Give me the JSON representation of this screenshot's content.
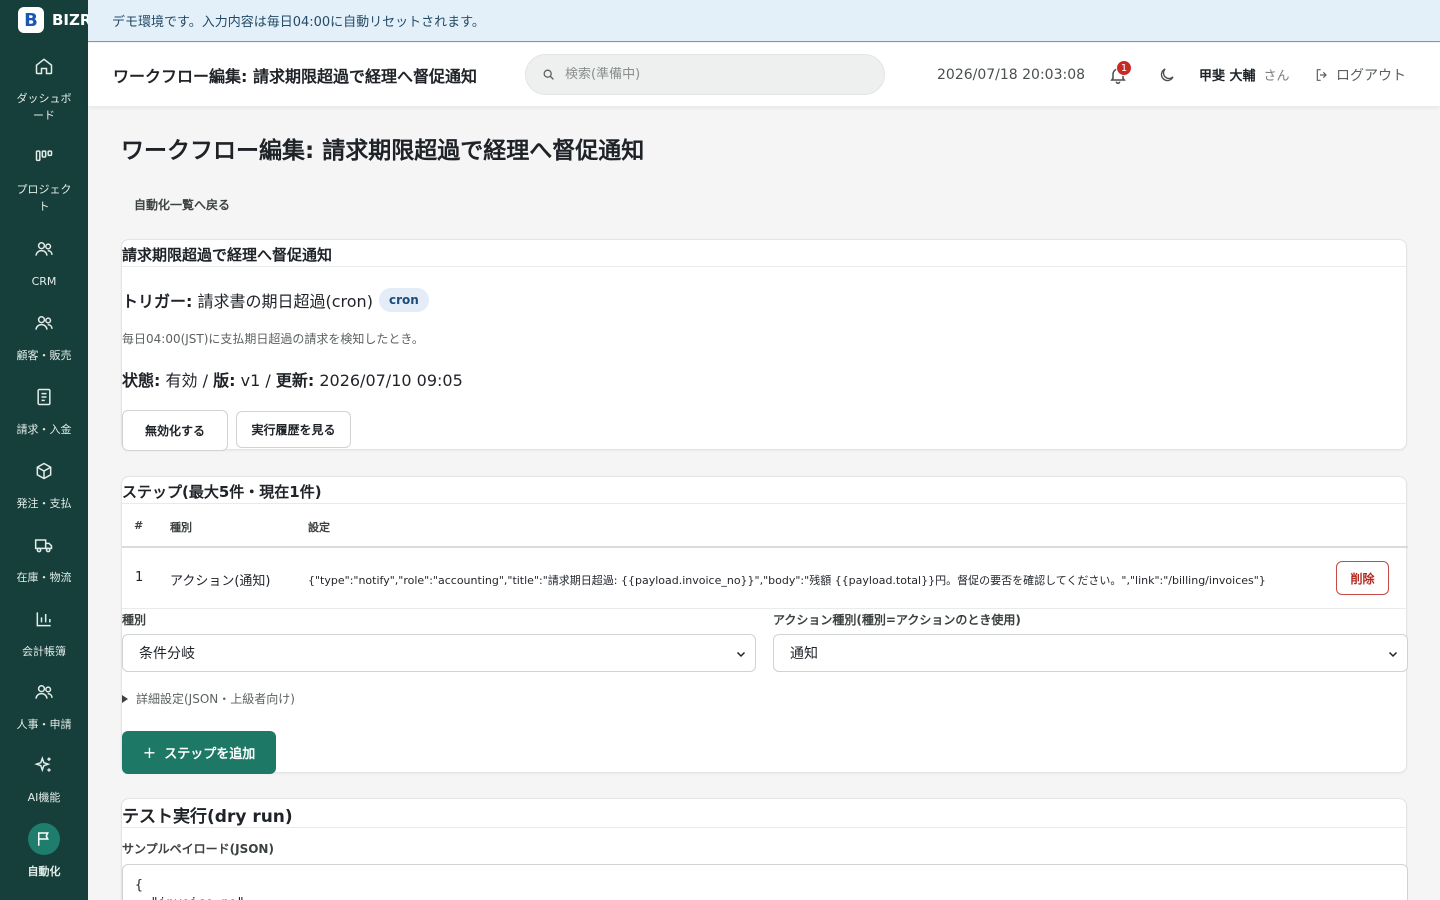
{
  "brand": {
    "mark": "B",
    "name": "BIZR"
  },
  "banner": {
    "text": "デモ環境です。入力内容は毎日04:00に自動リセットされます。"
  },
  "sidebar": {
    "items": [
      {
        "label": "ダッシュボード",
        "icon": "home-icon"
      },
      {
        "label": "プロジェクト",
        "icon": "kanban-icon"
      },
      {
        "label": "CRM",
        "icon": "users-icon"
      },
      {
        "label": "顧客・販売",
        "icon": "users-icon"
      },
      {
        "label": "請求・入金",
        "icon": "document-icon"
      },
      {
        "label": "発注・支払",
        "icon": "box-icon"
      },
      {
        "label": "在庫・物流",
        "icon": "truck-icon"
      },
      {
        "label": "会計帳簿",
        "icon": "bar-chart-icon"
      },
      {
        "label": "人事・申請",
        "icon": "users-icon"
      },
      {
        "label": "AI機能",
        "icon": "sparkles-icon"
      },
      {
        "label": "自動化",
        "icon": "flag-icon"
      }
    ]
  },
  "header": {
    "title": "ワークフロー編集: 請求期限超過で経理へ督促通知",
    "search_placeholder": "検索(準備中)",
    "datetime": "2026/07/18 20:03:08",
    "notification_count": "1",
    "user_name": "甲斐 大輔",
    "user_suffix": "さん",
    "logout_label": "ログアウト"
  },
  "main": {
    "title": "ワークフロー編集: 請求期限超過で経理へ督促通知",
    "back_link": "自動化一覧へ戻る",
    "workflow": {
      "name": "請求期限超過で経理へ督促通知",
      "trigger_label": "トリガー:",
      "trigger_value": "請求書の期日超過(cron)",
      "trigger_tag": "cron",
      "trigger_desc": "毎日04:00(JST)に支払期日超過の請求を検知したとき。",
      "status_label": "状態:",
      "status_value": "有効",
      "version_label": "版:",
      "version_value": "v1",
      "updated_label": "更新:",
      "updated_value": "2026/07/10 09:05",
      "sep": "/",
      "disable_button": "無効化する",
      "history_button": "実行履歴を見る"
    },
    "steps": {
      "title": "ステップ(最大5件・現在1件)",
      "columns": [
        "#",
        "種別",
        "設定"
      ],
      "rows": [
        {
          "num": "1",
          "type": "アクション(通知)",
          "config": "{\"type\":\"notify\",\"role\":\"accounting\",\"title\":\"請求期日超過: {{payload.invoice_no}}\",\"body\":\"残額 {{payload.total}}円。督促の要否を確認してください。\",\"link\":\"/billing/invoices\"}",
          "delete_label": "削除"
        }
      ],
      "kind_label": "種別",
      "kind_value": "条件分岐",
      "action_kind_label": "アクション種別(種別=アクションのとき使用)",
      "action_kind_value": "通知",
      "details_label": "詳細設定(JSON・上級者向け)",
      "add_button": "ステップを追加",
      "add_icon": "+"
    },
    "test": {
      "title": "テスト実行(dry run)",
      "payload_label": "サンプルペイロード(JSON)",
      "payload_value": "{\n  \"invoice_no\": "
    }
  },
  "colors": {
    "sidebar": "#163f3b",
    "accent": "#1e7866",
    "danger": "#c62b25",
    "banner": "#e4f0f9"
  }
}
